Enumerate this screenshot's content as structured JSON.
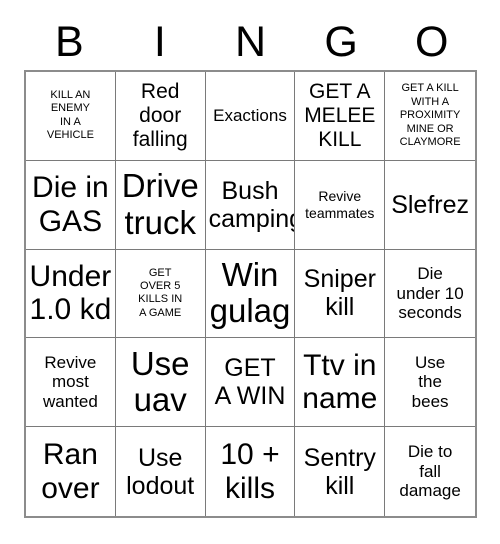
{
  "card": {
    "title": "BINGO",
    "header_letters": [
      "B",
      "I",
      "N",
      "G",
      "O"
    ],
    "grid_size": "5x5",
    "colors": {
      "text": "#000000",
      "background": "#ffffff",
      "grid_line": "#7a7a7a",
      "grid_outer": "#8c8c8c"
    },
    "cells": [
      {
        "text": "KILL AN\nENEMY\nIN A\nVEHICLE",
        "size": "xs",
        "marked": false
      },
      {
        "text": "Red\ndoor\nfalling",
        "size": "l",
        "marked": false
      },
      {
        "text": "Exactions",
        "size": "m",
        "marked": false
      },
      {
        "text": "GET A\nMELEE\nKILL",
        "size": "l",
        "marked": false
      },
      {
        "text": "GET A KILL\nWITH A\nPROXIMITY\nMINE OR\nCLAYMORE",
        "size": "xs",
        "marked": false
      },
      {
        "text": "Die in\nGAS",
        "size": "xxl",
        "marked": false
      },
      {
        "text": "Drive\ntruck",
        "size": "xxxl",
        "marked": false
      },
      {
        "text": "Bush\ncamping",
        "size": "xl",
        "marked": false
      },
      {
        "text": "Revive\nteammates",
        "size": "s",
        "marked": false
      },
      {
        "text": "Slefrez",
        "size": "xl",
        "marked": false
      },
      {
        "text": "Under\n1.0 kd",
        "size": "xxl",
        "marked": false
      },
      {
        "text": "GET\nOVER 5\nKILLS IN\nA GAME",
        "size": "xs",
        "marked": false
      },
      {
        "text": "Win\ngulag",
        "size": "xxxl",
        "marked": false
      },
      {
        "text": "Sniper\nkill",
        "size": "xl",
        "marked": false
      },
      {
        "text": "Die\nunder 10\nseconds",
        "size": "m",
        "marked": false
      },
      {
        "text": "Revive\nmost\nwanted",
        "size": "m",
        "marked": false
      },
      {
        "text": "Use\nuav",
        "size": "xxxl",
        "marked": false
      },
      {
        "text": "GET\nA WIN",
        "size": "xl",
        "marked": false
      },
      {
        "text": "Ttv in\nname",
        "size": "xxl",
        "marked": false
      },
      {
        "text": "Use\nthe\nbees",
        "size": "m",
        "marked": false
      },
      {
        "text": "Ran\nover",
        "size": "xxl",
        "marked": false
      },
      {
        "text": "Use\nlodout",
        "size": "xl",
        "marked": false
      },
      {
        "text": "10 +\nkills",
        "size": "xxl",
        "marked": false
      },
      {
        "text": "Sentry\nkill",
        "size": "xl",
        "marked": false
      },
      {
        "text": "Die to\nfall\ndamage",
        "size": "m",
        "marked": false
      }
    ]
  }
}
